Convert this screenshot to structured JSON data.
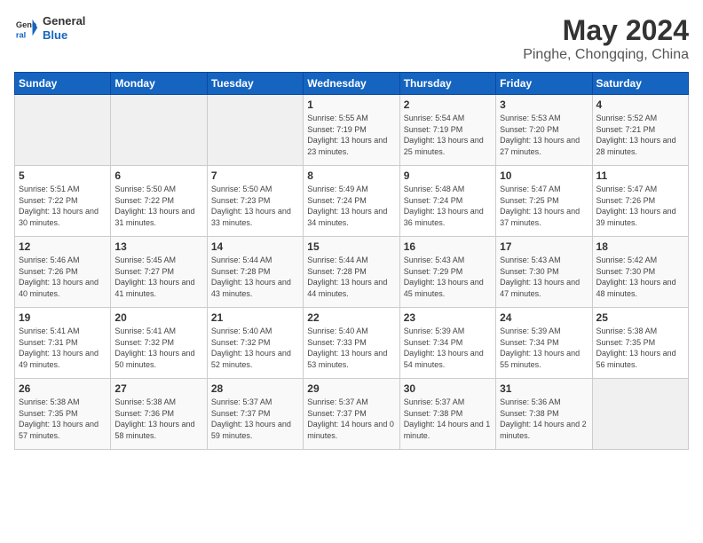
{
  "header": {
    "logo_line1": "General",
    "logo_line2": "Blue",
    "title": "May 2024",
    "subtitle": "Pinghe, Chongqing, China"
  },
  "weekdays": [
    "Sunday",
    "Monday",
    "Tuesday",
    "Wednesday",
    "Thursday",
    "Friday",
    "Saturday"
  ],
  "weeks": [
    [
      {
        "day": "",
        "empty": true
      },
      {
        "day": "",
        "empty": true
      },
      {
        "day": "",
        "empty": true
      },
      {
        "day": "1",
        "sunrise": "Sunrise: 5:55 AM",
        "sunset": "Sunset: 7:19 PM",
        "daylight": "Daylight: 13 hours and 23 minutes."
      },
      {
        "day": "2",
        "sunrise": "Sunrise: 5:54 AM",
        "sunset": "Sunset: 7:19 PM",
        "daylight": "Daylight: 13 hours and 25 minutes."
      },
      {
        "day": "3",
        "sunrise": "Sunrise: 5:53 AM",
        "sunset": "Sunset: 7:20 PM",
        "daylight": "Daylight: 13 hours and 27 minutes."
      },
      {
        "day": "4",
        "sunrise": "Sunrise: 5:52 AM",
        "sunset": "Sunset: 7:21 PM",
        "daylight": "Daylight: 13 hours and 28 minutes."
      }
    ],
    [
      {
        "day": "5",
        "sunrise": "Sunrise: 5:51 AM",
        "sunset": "Sunset: 7:22 PM",
        "daylight": "Daylight: 13 hours and 30 minutes."
      },
      {
        "day": "6",
        "sunrise": "Sunrise: 5:50 AM",
        "sunset": "Sunset: 7:22 PM",
        "daylight": "Daylight: 13 hours and 31 minutes."
      },
      {
        "day": "7",
        "sunrise": "Sunrise: 5:50 AM",
        "sunset": "Sunset: 7:23 PM",
        "daylight": "Daylight: 13 hours and 33 minutes."
      },
      {
        "day": "8",
        "sunrise": "Sunrise: 5:49 AM",
        "sunset": "Sunset: 7:24 PM",
        "daylight": "Daylight: 13 hours and 34 minutes."
      },
      {
        "day": "9",
        "sunrise": "Sunrise: 5:48 AM",
        "sunset": "Sunset: 7:24 PM",
        "daylight": "Daylight: 13 hours and 36 minutes."
      },
      {
        "day": "10",
        "sunrise": "Sunrise: 5:47 AM",
        "sunset": "Sunset: 7:25 PM",
        "daylight": "Daylight: 13 hours and 37 minutes."
      },
      {
        "day": "11",
        "sunrise": "Sunrise: 5:47 AM",
        "sunset": "Sunset: 7:26 PM",
        "daylight": "Daylight: 13 hours and 39 minutes."
      }
    ],
    [
      {
        "day": "12",
        "sunrise": "Sunrise: 5:46 AM",
        "sunset": "Sunset: 7:26 PM",
        "daylight": "Daylight: 13 hours and 40 minutes."
      },
      {
        "day": "13",
        "sunrise": "Sunrise: 5:45 AM",
        "sunset": "Sunset: 7:27 PM",
        "daylight": "Daylight: 13 hours and 41 minutes."
      },
      {
        "day": "14",
        "sunrise": "Sunrise: 5:44 AM",
        "sunset": "Sunset: 7:28 PM",
        "daylight": "Daylight: 13 hours and 43 minutes."
      },
      {
        "day": "15",
        "sunrise": "Sunrise: 5:44 AM",
        "sunset": "Sunset: 7:28 PM",
        "daylight": "Daylight: 13 hours and 44 minutes."
      },
      {
        "day": "16",
        "sunrise": "Sunrise: 5:43 AM",
        "sunset": "Sunset: 7:29 PM",
        "daylight": "Daylight: 13 hours and 45 minutes."
      },
      {
        "day": "17",
        "sunrise": "Sunrise: 5:43 AM",
        "sunset": "Sunset: 7:30 PM",
        "daylight": "Daylight: 13 hours and 47 minutes."
      },
      {
        "day": "18",
        "sunrise": "Sunrise: 5:42 AM",
        "sunset": "Sunset: 7:30 PM",
        "daylight": "Daylight: 13 hours and 48 minutes."
      }
    ],
    [
      {
        "day": "19",
        "sunrise": "Sunrise: 5:41 AM",
        "sunset": "Sunset: 7:31 PM",
        "daylight": "Daylight: 13 hours and 49 minutes."
      },
      {
        "day": "20",
        "sunrise": "Sunrise: 5:41 AM",
        "sunset": "Sunset: 7:32 PM",
        "daylight": "Daylight: 13 hours and 50 minutes."
      },
      {
        "day": "21",
        "sunrise": "Sunrise: 5:40 AM",
        "sunset": "Sunset: 7:32 PM",
        "daylight": "Daylight: 13 hours and 52 minutes."
      },
      {
        "day": "22",
        "sunrise": "Sunrise: 5:40 AM",
        "sunset": "Sunset: 7:33 PM",
        "daylight": "Daylight: 13 hours and 53 minutes."
      },
      {
        "day": "23",
        "sunrise": "Sunrise: 5:39 AM",
        "sunset": "Sunset: 7:34 PM",
        "daylight": "Daylight: 13 hours and 54 minutes."
      },
      {
        "day": "24",
        "sunrise": "Sunrise: 5:39 AM",
        "sunset": "Sunset: 7:34 PM",
        "daylight": "Daylight: 13 hours and 55 minutes."
      },
      {
        "day": "25",
        "sunrise": "Sunrise: 5:38 AM",
        "sunset": "Sunset: 7:35 PM",
        "daylight": "Daylight: 13 hours and 56 minutes."
      }
    ],
    [
      {
        "day": "26",
        "sunrise": "Sunrise: 5:38 AM",
        "sunset": "Sunset: 7:35 PM",
        "daylight": "Daylight: 13 hours and 57 minutes."
      },
      {
        "day": "27",
        "sunrise": "Sunrise: 5:38 AM",
        "sunset": "Sunset: 7:36 PM",
        "daylight": "Daylight: 13 hours and 58 minutes."
      },
      {
        "day": "28",
        "sunrise": "Sunrise: 5:37 AM",
        "sunset": "Sunset: 7:37 PM",
        "daylight": "Daylight: 13 hours and 59 minutes."
      },
      {
        "day": "29",
        "sunrise": "Sunrise: 5:37 AM",
        "sunset": "Sunset: 7:37 PM",
        "daylight": "Daylight: 14 hours and 0 minutes."
      },
      {
        "day": "30",
        "sunrise": "Sunrise: 5:37 AM",
        "sunset": "Sunset: 7:38 PM",
        "daylight": "Daylight: 14 hours and 1 minute."
      },
      {
        "day": "31",
        "sunrise": "Sunrise: 5:36 AM",
        "sunset": "Sunset: 7:38 PM",
        "daylight": "Daylight: 14 hours and 2 minutes."
      },
      {
        "day": "",
        "empty": true
      }
    ]
  ]
}
